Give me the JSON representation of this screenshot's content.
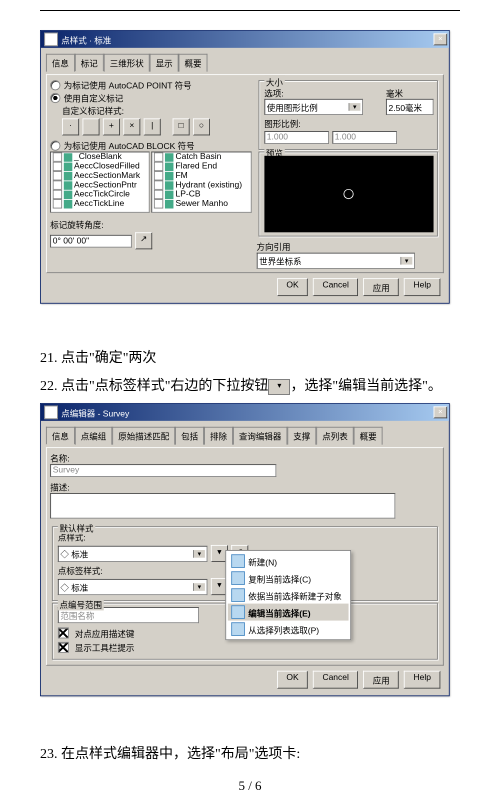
{
  "win1": {
    "title": "点样式 · 标准",
    "tabs": [
      "信息",
      "标记",
      "三维形状",
      "显示",
      "概要"
    ],
    "r1": "为标记使用 AutoCAD POINT 符号",
    "r2": "使用自定义标记",
    "r2sub": "自定义标记样式:",
    "r3": "为标记使用 AutoCAD BLOCK 符号",
    "list_l": [
      "_CloseBlank",
      "AeccClosedFilled",
      "AeccSectionMark",
      "AeccSectionPntr",
      "AeccTickCircle",
      "AeccTickLine"
    ],
    "list_r": [
      "Catch Basin",
      "Flared End",
      "FM",
      "Hydrant (existing)",
      "LP-CB",
      "Sewer Manho"
    ],
    "rot_lbl": "标记旋转角度:",
    "rot_val": "0° 00' 00\"",
    "size_lbl": "大小",
    "size_opt_lbl": "选项:",
    "size_opt": "使用图形比例",
    "unit_lbl": "毫米",
    "unit_val": "2.50毫米",
    "scale_lbl": "图形比例:",
    "scale_val": "1.000",
    "scale_val2": "1.000",
    "prev": "预览",
    "orient_lbl": "方向引用",
    "orient_val": "世界坐标系",
    "btns": [
      "OK",
      "Cancel",
      "应用",
      "Help"
    ]
  },
  "i21": "21.  点击\"确定\"两次",
  "i22_a": "22.  点击\"点标签样式\"右边的下拉按钮",
  "i22_b": "，选择\"编辑当前选择\"。",
  "win2": {
    "title": "点编辑器 - Survey",
    "tabs": [
      "信息",
      "点编组",
      "原始描述匹配",
      "包括",
      "排除",
      "查询编辑器",
      "支撑",
      "点列表",
      "概要"
    ],
    "name_lbl": "名称:",
    "name_val": "Survey",
    "desc_lbl": "描述:",
    "def_lbl": "默认样式",
    "pts_lbl": "点样式:",
    "pts_val": "◇ 标准",
    "lbl_lbl": "点标签样式:",
    "lbl_val": "◇ 标准",
    "pn_lbl": "点编号范围",
    "pn_col": "范围名称",
    "chk1": "对点应用描述键",
    "chk2": "显示工具栏提示",
    "menu": [
      "新建(N)",
      "复制当前选择(C)",
      "依据当前选择新建子对象",
      "编辑当前选择(E)",
      "从选择列表选取(P)"
    ],
    "btns": [
      "OK",
      "Cancel",
      "应用",
      "Help"
    ]
  },
  "i23": "23.  在点样式编辑器中，选择\"布局\"选项卡:",
  "page": "5  /  6"
}
